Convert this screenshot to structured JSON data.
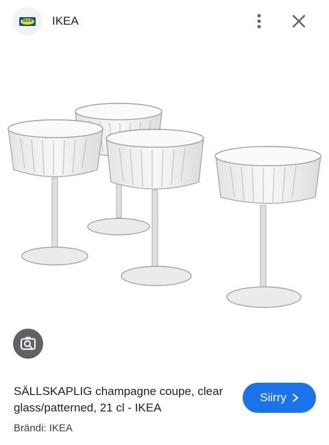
{
  "header": {
    "logo_text": "IKEA",
    "site_name": "IKEA",
    "more_icon": "more-vert-icon",
    "close_icon": "close-icon"
  },
  "image": {
    "subject": "four crystal-patterned champagne coupes"
  },
  "lens_icon": "google-lens-icon",
  "product": {
    "title": "SÄLLSKAPLIG champagne coupe, clear glass/patterned, 21 cl - IKEA",
    "brand": "Brändi: IKEA"
  },
  "visit_button": {
    "label": "Siirry",
    "icon": "chevron-right-icon",
    "color": "#1a73e8"
  },
  "colors": {
    "ikea_blue": "#0058a3",
    "ikea_yellow": "#ffdb00"
  }
}
